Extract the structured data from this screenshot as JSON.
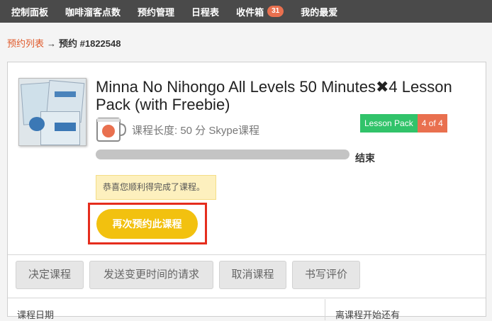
{
  "nav": {
    "items": [
      {
        "label": "控制面板"
      },
      {
        "label": "咖啡溜客点数"
      },
      {
        "label": "预约管理"
      },
      {
        "label": "日程表"
      },
      {
        "label": "收件箱",
        "badge": "31"
      },
      {
        "label": "我的最爱"
      }
    ]
  },
  "breadcrumb": {
    "link": "预约列表",
    "separator": "→",
    "current": "预约 #1822548"
  },
  "lesson": {
    "cover_icon": "book-cover-image",
    "title": "Minna No Nihongo All Levels 50 Minutes✖4 Lesson Pack (with Freebie)",
    "duration_icon": "coffee-cup-icon",
    "duration": "课程长度: 50 分 Skype课程",
    "pack_label": "Lesson Pack",
    "pack_count": "4 of 4",
    "progress_value": 1.0,
    "progress_status": "结束",
    "notice": "恭喜您顺利得完成了课程。",
    "rebook_label": "再次预约此课程"
  },
  "actions": {
    "confirm": "决定课程",
    "reschedule": "发送变更时间的请求",
    "cancel": "取消课程",
    "review": "书写评价"
  },
  "table": {
    "left_header": "课程日期",
    "right_header": "离课程开始还有"
  },
  "colors": {
    "nav_bg": "#4a4a4a",
    "badge": "#e9704f",
    "link": "#e05a2b",
    "pack_green": "#31c36a",
    "rebook_yellow": "#f2c10f",
    "highlight_red": "#e52d1d"
  }
}
